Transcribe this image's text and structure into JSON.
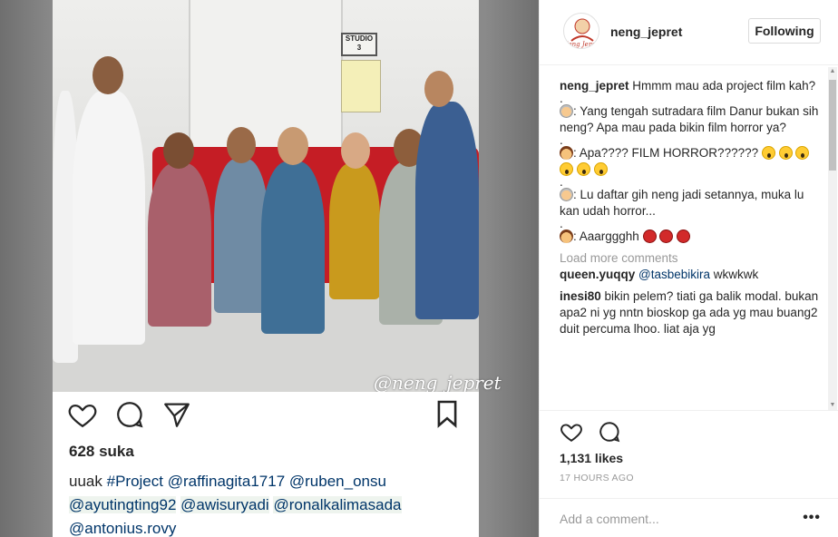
{
  "post": {
    "username": "neng_jepret",
    "follow_label": "Following",
    "avatar_text": "Neng Jepret",
    "image": {
      "studio_sign": "STUDIO",
      "studio_number": "3",
      "watermark": "@neng_jepret",
      "inner_likes": "628 suka",
      "inner_caption_prefix": "uuak",
      "inner_caption_tags": [
        "#Project",
        "@raffinagita1717",
        "@ruben_onsu",
        "@ayutingting92",
        "@awisuryadi",
        "@ronalkalimasada",
        "@antonius.rovy"
      ]
    },
    "caption_text": "Hmmm mau ada project film kah?",
    "comments_in_caption": [
      {
        "text": ": Yang tengah sutradara film Danur bukan sih neng? Apa mau pada bikin film horror ya?"
      },
      {
        "text": ": Apa???? FILM HORROR?????? "
      },
      {
        "text": ": Lu daftar gih neng jadi setannya, muka lu kan udah horror..."
      },
      {
        "text": ": Aaarggghh "
      }
    ],
    "dot": ".",
    "load_more": "Load more comments",
    "comments": [
      {
        "user": "queen.yuqqy",
        "mention": "@tasbebikira",
        "text": " wkwkwk"
      },
      {
        "user": "inesi80",
        "text": " bikin pelem? tiati ga balik modal. bukan apa2 ni yg nntn bioskop ga ada yg mau buang2 duit percuma lhoo. liat aja yg"
      }
    ],
    "likes": "1,131 likes",
    "timestamp": "17 HOURS AGO",
    "add_comment_placeholder": "Add a comment...",
    "more_label": "•••"
  },
  "colors": {
    "link": "#003569",
    "muted": "#999999",
    "couch": "#c51d25"
  }
}
